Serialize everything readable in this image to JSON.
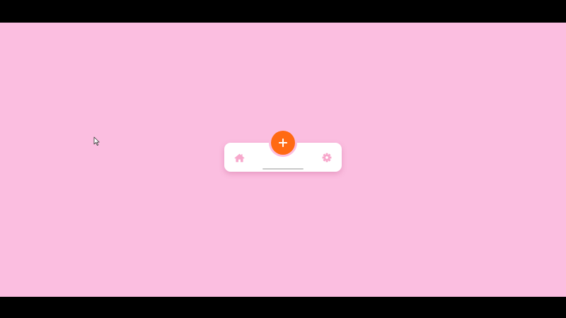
{
  "colors": {
    "background": "#fbbee0",
    "letterbox": "#000000",
    "nav_bar": "#ffffff",
    "fab": "#ff6a13",
    "icon_tint": "#f7a8cc",
    "home_indicator": "#c9c9c9"
  },
  "nav": {
    "items": [
      {
        "icon": "home-icon",
        "label": ""
      },
      {
        "icon": "gear-icon",
        "label": ""
      }
    ],
    "fab": {
      "icon": "plus-icon"
    }
  }
}
